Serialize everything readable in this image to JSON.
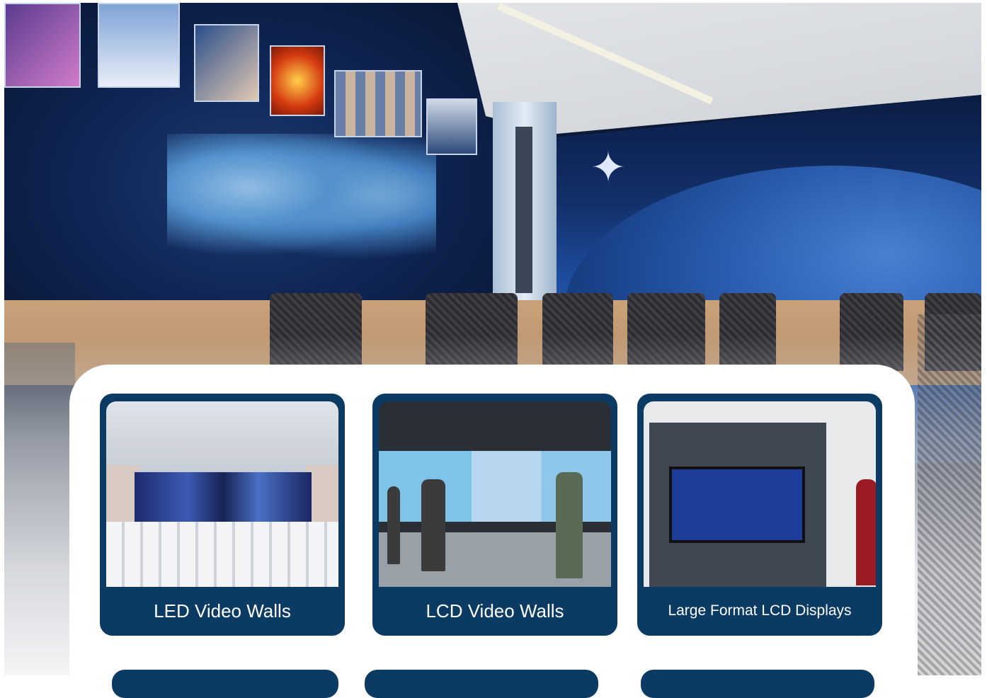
{
  "page": {
    "hero_alt": "Control room with curved LED video wall showing world map and earth imagery"
  },
  "cards": [
    {
      "id": "led",
      "label": "LED Video Walls",
      "image_alt": "LED video wall in conference hall"
    },
    {
      "id": "lcd",
      "label": "LCD Video Walls",
      "image_alt": "People in front of LCD video wall"
    },
    {
      "id": "large-format",
      "label": "Large Format LCD Displays",
      "image_alt": "Large format LCD display on wall"
    }
  ],
  "colors": {
    "card_bg": "#0b3a63",
    "card_text": "#ffffff",
    "panel_bg": "#ffffff"
  }
}
